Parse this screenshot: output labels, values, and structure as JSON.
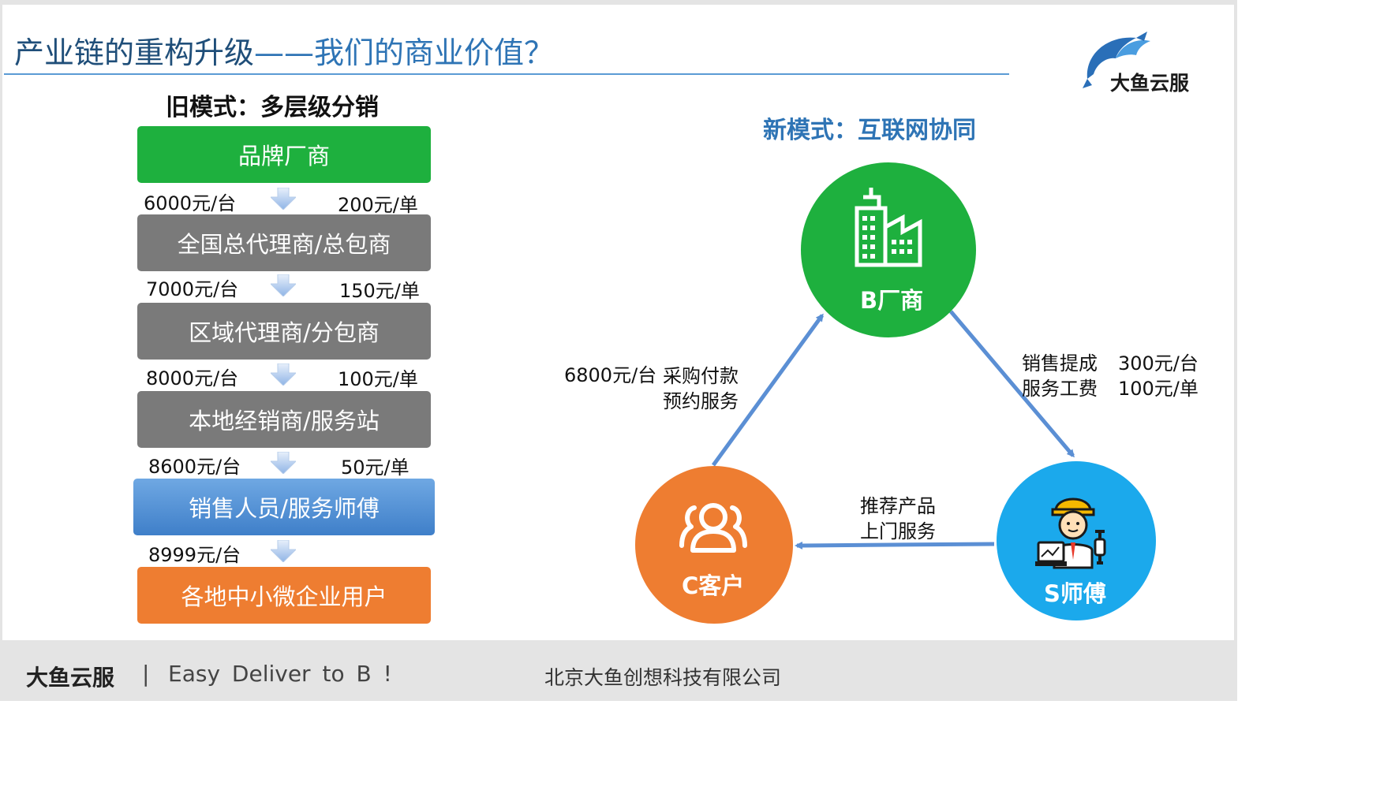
{
  "header": {
    "title_main": "产业链的重构升级",
    "title_accent": "——我们的商业价值？",
    "logo_text": "大鱼云服"
  },
  "old_model": {
    "title": "旧模式：多层级分销",
    "levels": [
      "品牌厂商",
      "全国总代理商/总包商",
      "区域代理商/分包商",
      "本地经销商/服务站",
      "销售人员/服务师傅",
      "各地中小微企业用户"
    ],
    "prices": [
      {
        "unit_price": "6000元/台",
        "order_price": "200元/单"
      },
      {
        "unit_price": "7000元/台",
        "order_price": "150元/单"
      },
      {
        "unit_price": "8000元/台",
        "order_price": "100元/单"
      },
      {
        "unit_price": "8600元/台",
        "order_price": "50元/单"
      },
      {
        "unit_price": "8999元/台",
        "order_price": ""
      }
    ]
  },
  "new_model": {
    "title": "新模式：互联网协同",
    "nodes": {
      "b": {
        "label": "B厂商",
        "icon": "building-icon",
        "color": "#1eb03e"
      },
      "c": {
        "label": "C客户",
        "icon": "users-icon",
        "color": "#ee7d31"
      },
      "s": {
        "label": "S师傅",
        "icon": "worker-icon",
        "color": "#1ba9ec"
      }
    },
    "edges": {
      "c_to_b": {
        "price": "6800元/台",
        "line1": "采购付款",
        "line2": "预约服务"
      },
      "b_to_s": {
        "line1": "销售提成",
        "value1": "300元/台",
        "line2": "服务工费",
        "value2": "100元/单"
      },
      "s_to_c": {
        "line1": "推荐产品",
        "line2": "上门服务"
      }
    }
  },
  "footer": {
    "brand": "大鱼云服",
    "separator": "|",
    "slogan": "Easy Deliver to B !",
    "company": "北京大鱼创想科技有限公司"
  },
  "colors": {
    "title": "#1f4e79",
    "accent": "#2e74b5",
    "arrow": "#5b8fd4"
  }
}
